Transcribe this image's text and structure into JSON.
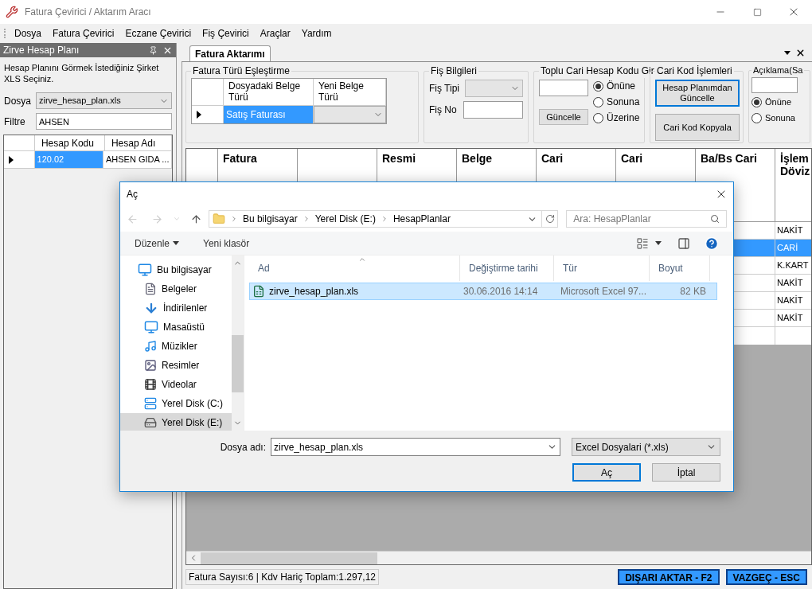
{
  "window": {
    "title": "Fatura Çevirici / Aktarım Aracı"
  },
  "menu": [
    "Dosya",
    "Fatura Çevirici",
    "Eczane Çevirici",
    "Fiş Çevirici",
    "Araçlar",
    "Yardım"
  ],
  "side_panel": {
    "title": "Zirve Hesap Planı",
    "description": "Hesap Planını Görmek İstediğiniz Şirket XLS Seçiniz.",
    "file_label": "Dosya",
    "file_value": "zirve_hesap_plan.xls",
    "filter_label": "Filtre",
    "filter_value": "AHSEN",
    "grid": {
      "columns": [
        "Hesap Kodu",
        "Hesap Adı"
      ],
      "rows": [
        {
          "cells": [
            "120.02",
            "AHSEN GIDA ..."
          ],
          "selected": true
        }
      ]
    }
  },
  "document_tabs": [
    {
      "label": "Fatura Aktarımı",
      "selected": true
    }
  ],
  "type_mapping": {
    "title": "Fatura Türü Eşleştirme",
    "columns": [
      "Dosyadaki Belge Türü",
      "Yeni Belge Türü"
    ],
    "rows": [
      {
        "source": "Satış Faturası",
        "selected": true
      }
    ]
  },
  "fis_info": {
    "title": "Fiş Bilgileri",
    "type_label": "Fiş Tipi",
    "no_label": "Fiş No"
  },
  "bulk_code": {
    "title": "Toplu Cari Hesap Kodu Gir",
    "button": "Güncelle",
    "options": [
      {
        "label": "Önüne",
        "selected": true
      },
      {
        "label": "Sonuna",
        "selected": false
      },
      {
        "label": "Üzerine",
        "selected": false
      }
    ]
  },
  "code_ops": {
    "title": "Cari Kod İşlemleri",
    "buttons": [
      {
        "label": "Hesap Planımdan Güncelle",
        "focused": true
      },
      {
        "label": "Cari Kod Kopyala",
        "focused": false
      }
    ]
  },
  "description_group": {
    "title": "Açıklama(Sa",
    "options": [
      {
        "label": "Önüne",
        "selected": true
      },
      {
        "label": "Sonuna",
        "selected": false
      }
    ]
  },
  "main_grid": {
    "columns": [
      {
        "label": "Fatura"
      },
      {},
      {
        "label": "Resmi"
      },
      {
        "label": "Belge"
      },
      {
        "label": "Cari"
      },
      {
        "label": "Cari"
      },
      {
        "label": "Ba/Bs Cari"
      },
      {
        "label": "İşlem Döviz"
      }
    ],
    "rows": [
      {
        "islem_doviz": "NAKİT",
        "selected": false
      },
      {
        "islem_doviz": "CARİ",
        "selected": true
      },
      {
        "islem_doviz": "K.KART",
        "selected": false
      },
      {
        "islem_doviz": "NAKİT",
        "selected": false
      },
      {
        "islem_doviz": "NAKİT",
        "selected": false
      },
      {
        "islem_doviz": "NAKİT",
        "selected": false
      }
    ]
  },
  "status": "Fatura Sayısı:6 | Kdv Hariç Toplam:1.297,12",
  "actions": [
    "DIŞARI AKTAR - F2",
    "VAZGEÇ - ESC"
  ],
  "open_dialog": {
    "title": "Aç",
    "path": [
      "Bu bilgisayar",
      "Yerel Disk (E:)",
      "HesapPlanlar"
    ],
    "search_placeholder": "Ara: HesapPlanlar",
    "organize": "Düzenle",
    "new_folder": "Yeni klasör",
    "nav": [
      {
        "label": "Bu bilgisayar",
        "kind": "computer",
        "selected": false,
        "children": [
          {
            "label": "Belgeler",
            "kind": "documents",
            "selected": false
          },
          {
            "label": "İndirilenler",
            "kind": "downloads",
            "selected": false
          },
          {
            "label": "Masaüstü",
            "kind": "desktop",
            "selected": false
          },
          {
            "label": "Müzikler",
            "kind": "music",
            "selected": false
          },
          {
            "label": "Resimler",
            "kind": "pictures",
            "selected": false
          },
          {
            "label": "Videolar",
            "kind": "videos",
            "selected": false
          },
          {
            "label": "Yerel Disk (C:)",
            "kind": "system_drive",
            "selected": false
          },
          {
            "label": "Yerel Disk (E:)",
            "kind": "drive",
            "selected": true
          }
        ]
      }
    ],
    "columns": [
      "Ad",
      "Değiştirme tarihi",
      "Tür",
      "Boyut"
    ],
    "files": [
      {
        "name": "zirve_hesap_plan.xls",
        "modified": "30.06.2016 14:14",
        "type": "Microsoft Excel 97...",
        "size": "82 KB",
        "selected": true
      }
    ],
    "file_name_label": "Dosya adı:",
    "file_name": "zirve_hesap_plan.xls",
    "filter": "Excel Dosyalari (*.xls)",
    "buttons": [
      {
        "label": "Aç",
        "default": true
      },
      {
        "label": "İptal",
        "default": false
      }
    ]
  }
}
